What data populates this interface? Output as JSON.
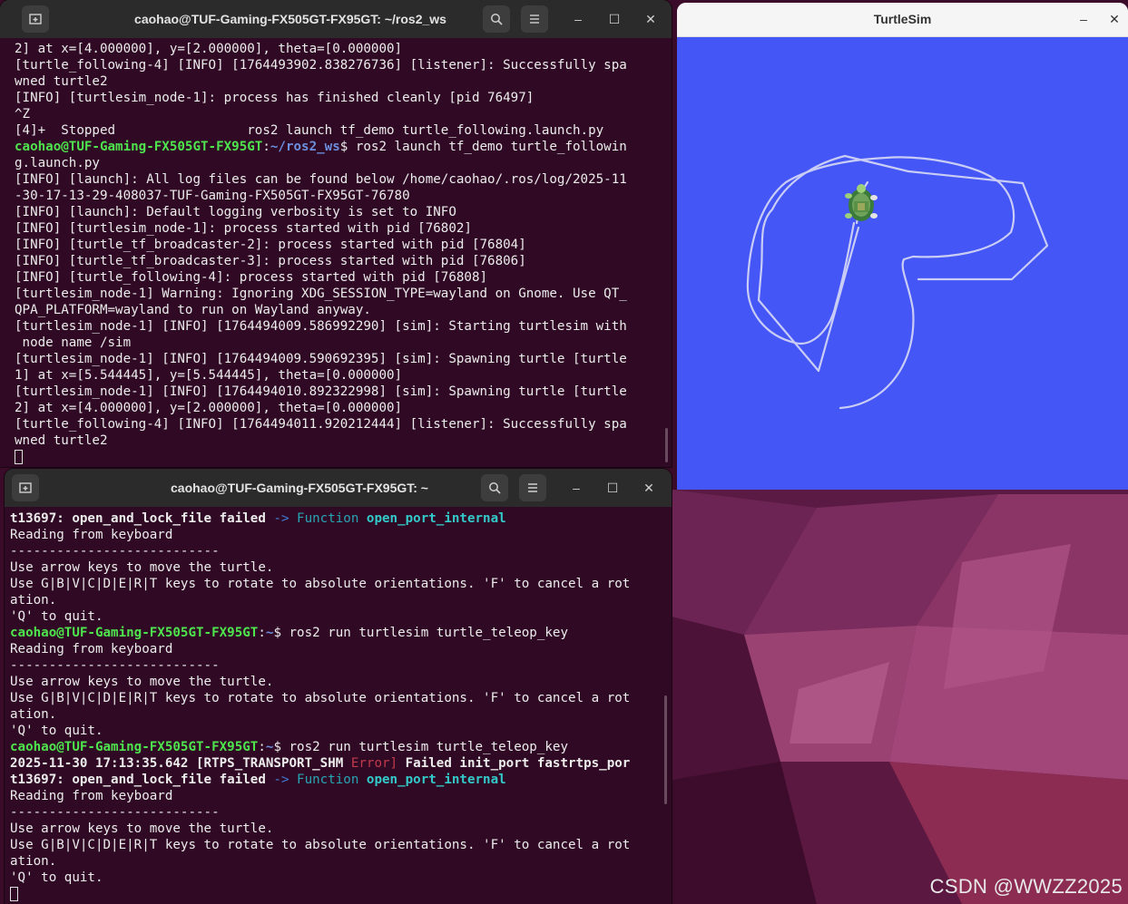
{
  "desktop": {
    "watermark": "CSDN @WWZZ2025"
  },
  "terminal_top": {
    "title": "caohao@TUF-Gaming-FX505GT-FX95GT: ~/ros2_ws",
    "new_tab_icon": "new-tab-icon",
    "search_icon": "search-icon",
    "menu_icon": "hamburger-menu-icon",
    "minimize": "–",
    "maximize": "☐",
    "close": "✕",
    "lines": [
      {
        "text": "2] at x=[4.000000], y=[2.000000], theta=[0.000000]"
      },
      {
        "text": "[turtle_following-4] [INFO] [1764493902.838276736] [listener]: Successfully spa"
      },
      {
        "text": "wned turtle2"
      },
      {
        "text": "[INFO] [turtlesim_node-1]: process has finished cleanly [pid 76497]"
      },
      {
        "text": "^Z"
      },
      {
        "text": "[4]+  Stopped                 ros2 launch tf_demo turtle_following.launch.py"
      },
      {
        "prompt": "caohao@TUF-Gaming-FX505GT-FX95GT",
        "path": "~/ros2_ws",
        "cmd": "$ ros2 launch tf_demo turtle_followin"
      },
      {
        "text": "g.launch.py"
      },
      {
        "text": "[INFO] [launch]: All log files can be found below /home/caohao/.ros/log/2025-11"
      },
      {
        "text": "-30-17-13-29-408037-TUF-Gaming-FX505GT-FX95GT-76780"
      },
      {
        "text": "[INFO] [launch]: Default logging verbosity is set to INFO"
      },
      {
        "text": "[INFO] [turtlesim_node-1]: process started with pid [76802]"
      },
      {
        "text": "[INFO] [turtle_tf_broadcaster-2]: process started with pid [76804]"
      },
      {
        "text": "[INFO] [turtle_tf_broadcaster-3]: process started with pid [76806]"
      },
      {
        "text": "[INFO] [turtle_following-4]: process started with pid [76808]"
      },
      {
        "text": "[turtlesim_node-1] Warning: Ignoring XDG_SESSION_TYPE=wayland on Gnome. Use QT_"
      },
      {
        "text": "QPA_PLATFORM=wayland to run on Wayland anyway."
      },
      {
        "text": "[turtlesim_node-1] [INFO] [1764494009.586992290] [sim]: Starting turtlesim with"
      },
      {
        "text": " node name /sim"
      },
      {
        "text": "[turtlesim_node-1] [INFO] [1764494009.590692395] [sim]: Spawning turtle [turtle"
      },
      {
        "text": "1] at x=[5.544445], y=[5.544445], theta=[0.000000]"
      },
      {
        "text": "[turtlesim_node-1] [INFO] [1764494010.892322998] [sim]: Spawning turtle [turtle"
      },
      {
        "text": "2] at x=[4.000000], y=[2.000000], theta=[0.000000]"
      },
      {
        "text": "[turtle_following-4] [INFO] [1764494011.920212444] [listener]: Successfully spa"
      },
      {
        "text": "wned turtle2"
      }
    ]
  },
  "terminal_bottom": {
    "title": "caohao@TUF-Gaming-FX505GT-FX95GT: ~",
    "minimize": "–",
    "maximize": "☐",
    "close": "✕",
    "lines": [
      {
        "bold": "t13697: open_and_lock_file failed",
        "arrow": " -> ",
        "fn": "Function",
        "fnname": " open_port_internal"
      },
      {
        "text": "Reading from keyboard"
      },
      {
        "text": "---------------------------"
      },
      {
        "text": "Use arrow keys to move the turtle."
      },
      {
        "text": "Use G|B|V|C|D|E|R|T keys to rotate to absolute orientations. 'F' to cancel a rot"
      },
      {
        "text": "ation."
      },
      {
        "text": "'Q' to quit."
      },
      {
        "prompt": "caohao@TUF-Gaming-FX505GT-FX95GT",
        "path": "~",
        "cmd": "$ ros2 run turtlesim turtle_teleop_key"
      },
      {
        "text": "Reading from keyboard"
      },
      {
        "text": "---------------------------"
      },
      {
        "text": "Use arrow keys to move the turtle."
      },
      {
        "text": "Use G|B|V|C|D|E|R|T keys to rotate to absolute orientations. 'F' to cancel a rot"
      },
      {
        "text": "ation."
      },
      {
        "text": "'Q' to quit."
      },
      {
        "prompt": "caohao@TUF-Gaming-FX505GT-FX95GT",
        "path": "~",
        "cmd": "$ ros2 run turtlesim turtle_teleop_key"
      },
      {
        "bold": "2025-11-30 17:13:35.642",
        "plain": " [RTPS_TRANSPORT_SHM ",
        "err": "Error]",
        "tail": " Failed init_port fastrtps_por"
      },
      {
        "bold": "t13697: open_and_lock_file failed",
        "arrow": " -> ",
        "fn": "Function",
        "fnname": " open_port_internal"
      },
      {
        "text": "Reading from keyboard"
      },
      {
        "text": "---------------------------"
      },
      {
        "text": "Use arrow keys to move the turtle."
      },
      {
        "text": "Use G|B|V|C|D|E|R|T keys to rotate to absolute orientations. 'F' to cancel a rot"
      },
      {
        "text": "ation."
      },
      {
        "text": "'Q' to quit."
      }
    ]
  },
  "turtlesim": {
    "title": "TurtleSim",
    "minimize": "–",
    "close": "✕",
    "background_color": "#4556f7",
    "trail_color": "#c9cdf5"
  }
}
